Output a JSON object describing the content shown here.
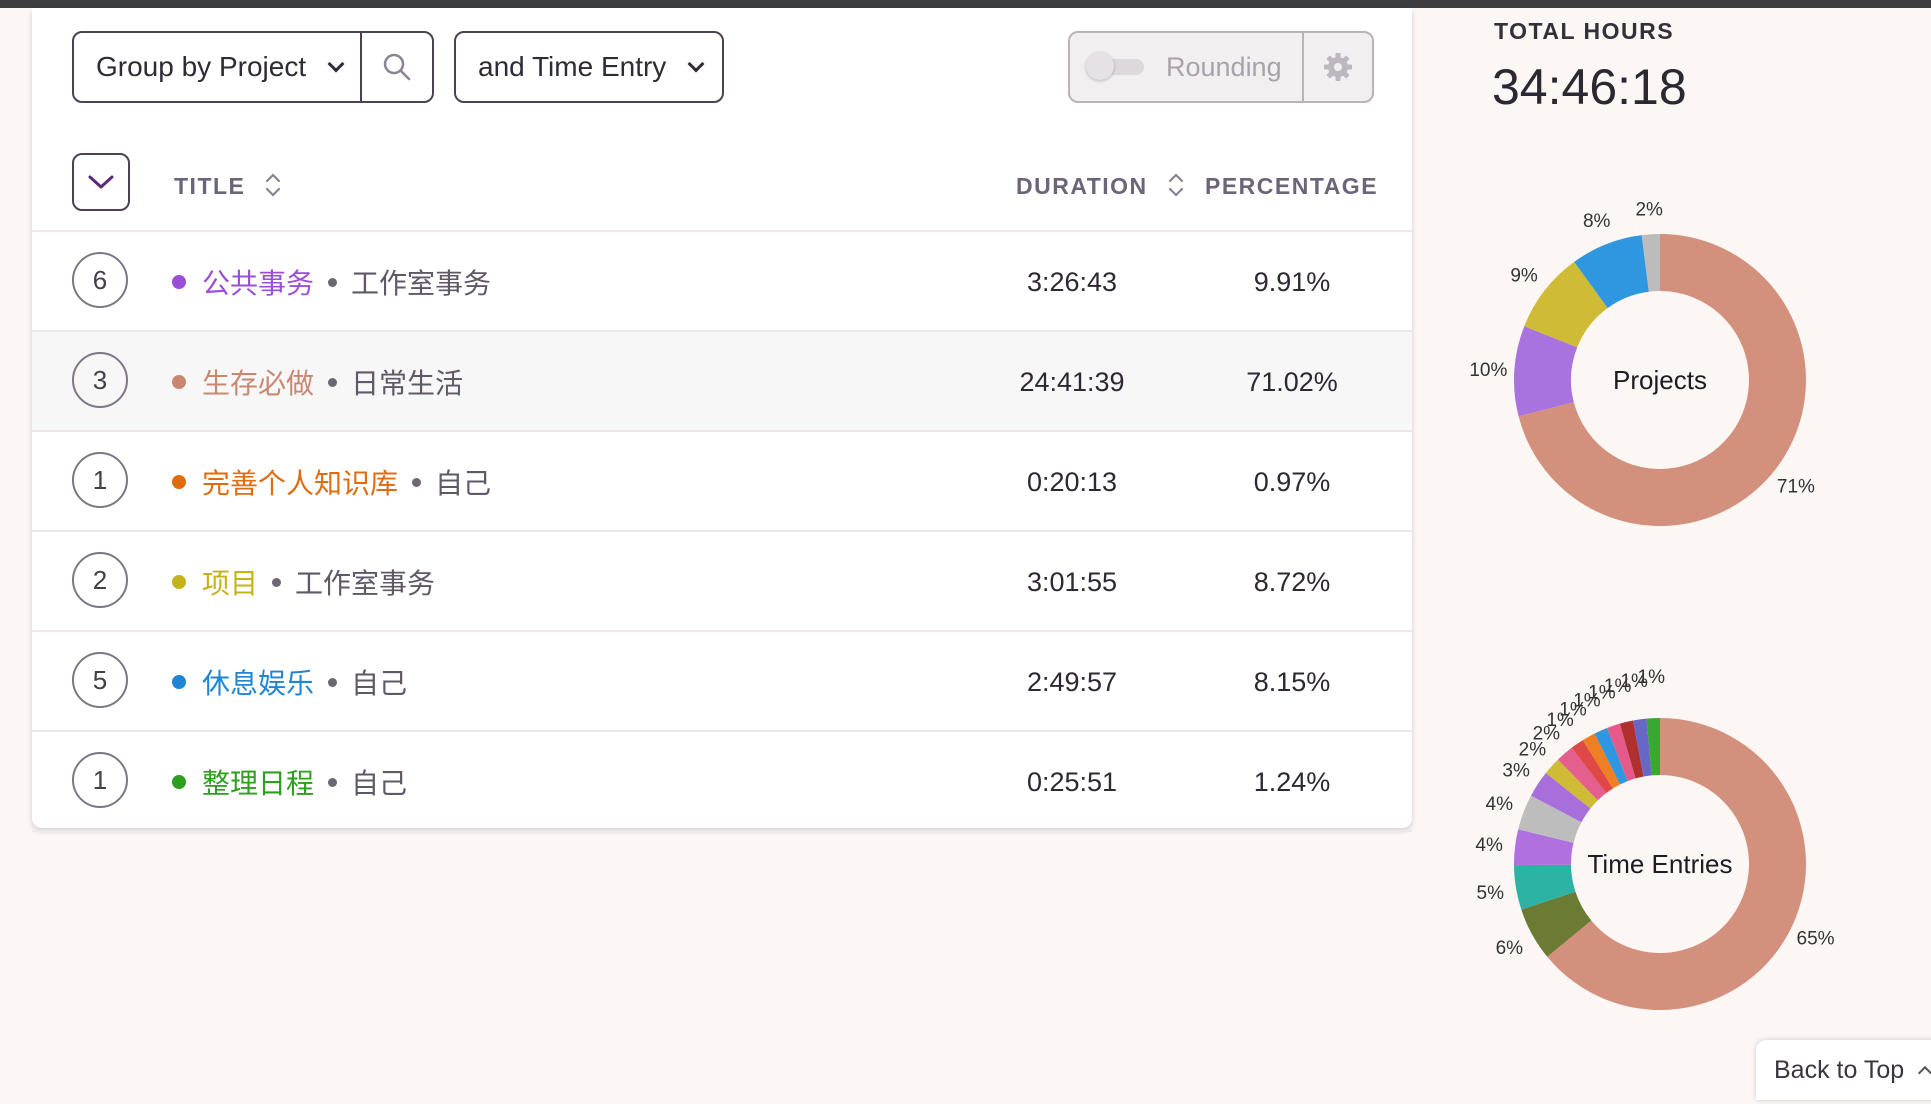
{
  "toolbar": {
    "group_by_label": "Group by Project",
    "and_label": "and Time Entry",
    "rounding_label": "Rounding"
  },
  "table": {
    "headers": {
      "title": "TITLE",
      "duration": "DURATION",
      "percentage": "PERCENTAGE"
    },
    "rows": [
      {
        "count": "6",
        "project": "公共事务",
        "client": "工作室事务",
        "duration": "3:26:43",
        "percentage": "9.91%",
        "color": "#9b4fd8",
        "alt": false
      },
      {
        "count": "3",
        "project": "生存必做",
        "client": "日常生活",
        "duration": "24:41:39",
        "percentage": "71.02%",
        "color": "#c98770",
        "alt": true
      },
      {
        "count": "1",
        "project": "完善个人知识库",
        "client": "自己",
        "duration": "0:20:13",
        "percentage": "0.97%",
        "color": "#e06c10",
        "alt": false
      },
      {
        "count": "2",
        "project": "项目",
        "client": "工作室事务",
        "duration": "3:01:55",
        "percentage": "8.72%",
        "color": "#c6b21c",
        "alt": false
      },
      {
        "count": "5",
        "project": "休息娱乐",
        "client": "自己",
        "duration": "2:49:57",
        "percentage": "8.15%",
        "color": "#1f86d6",
        "alt": false
      },
      {
        "count": "1",
        "project": "整理日程",
        "client": "自己",
        "duration": "0:25:51",
        "percentage": "1.24%",
        "color": "#2d9e1e",
        "alt": false
      }
    ]
  },
  "summary": {
    "total_label": "TOTAL HOURS",
    "total_value": "34:46:18"
  },
  "charts": {
    "projects": {
      "center_label": "Projects",
      "slices": [
        {
          "value": 71,
          "label": "71%",
          "color": "#d3917d"
        },
        {
          "value": 10,
          "label": "10%",
          "color": "#a973df"
        },
        {
          "value": 9,
          "label": "9%",
          "color": "#cfbb36"
        },
        {
          "value": 8,
          "label": "8%",
          "color": "#2f96e0"
        },
        {
          "value": 2,
          "label": "2%",
          "color": "#bcbcbc"
        }
      ]
    },
    "entries": {
      "center_label": "Time Entries",
      "slices": [
        {
          "value": 65,
          "label": "65%",
          "color": "#d3917d"
        },
        {
          "value": 6,
          "label": "6%",
          "color": "#6b7b34"
        },
        {
          "value": 5,
          "label": "5%",
          "color": "#2cb3a4"
        },
        {
          "value": 4,
          "label": "4%",
          "color": "#b070df"
        },
        {
          "value": 4,
          "label": "4%",
          "color": "#bdbdbd"
        },
        {
          "value": 3,
          "label": "3%",
          "color": "#a86fdc"
        },
        {
          "value": 2,
          "label": "2%",
          "color": "#cfbb36"
        },
        {
          "value": 2,
          "label": "2%",
          "color": "#e45e8e"
        },
        {
          "value": 1.5,
          "label": "1%",
          "color": "#e04848"
        },
        {
          "value": 1.5,
          "label": "1%",
          "color": "#ee7f22"
        },
        {
          "value": 1.5,
          "label": "1%",
          "color": "#2f96e0"
        },
        {
          "value": 1.5,
          "label": "1%",
          "color": "#e65a8a"
        },
        {
          "value": 1.5,
          "label": "1%",
          "color": "#b0302e"
        },
        {
          "value": 1.5,
          "label": "1%",
          "color": "#6767c8"
        },
        {
          "value": 1.5,
          "label": "1%",
          "color": "#38a830"
        }
      ]
    }
  },
  "footer": {
    "back_to_top": "Back to Top"
  }
}
